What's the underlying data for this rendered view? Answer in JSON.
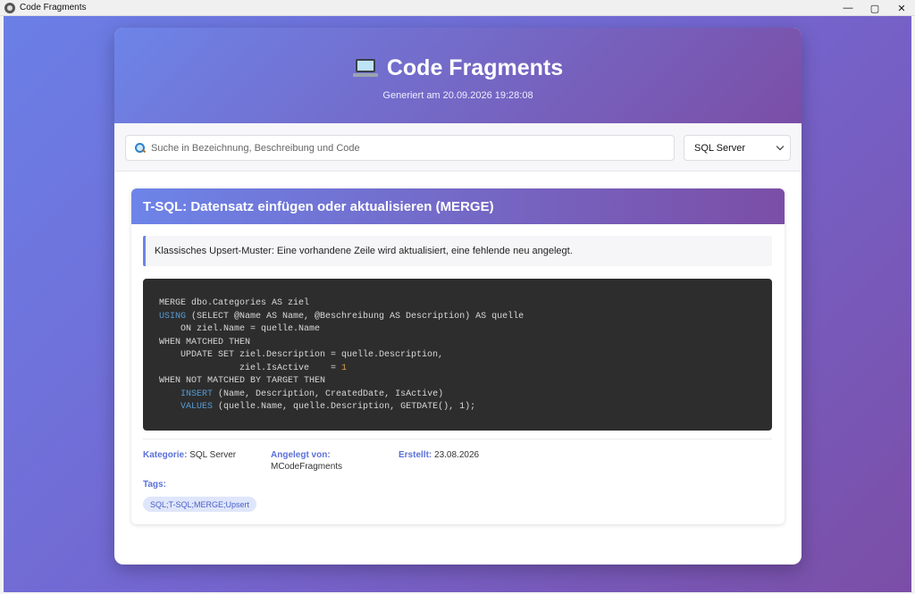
{
  "window": {
    "title": "Code Fragments",
    "minimize": "—",
    "maximize": "▢",
    "close": "✕"
  },
  "header": {
    "title": "Code Fragments",
    "subtitle": "Generiert am 20.09.2026 19:28:08"
  },
  "toolbar": {
    "search_placeholder": "Suche in Bezeichnung, Beschreibung und Code",
    "search_value": "",
    "filter_selected": "SQL Server"
  },
  "snippet": {
    "title": "T-SQL: Datensatz einfügen oder aktualisieren (MERGE)",
    "description": "Klassisches Upsert-Muster: Eine vorhandene Zeile wird aktualisiert, eine fehlende neu angelegt.",
    "code_lines": [
      [
        "MERGE dbo.Categories AS ziel"
      ],
      [
        {
          "kw": "USING"
        },
        " (SELECT @Name AS Name, @Beschreibung AS Description) AS quelle"
      ],
      [
        "    ON ziel.Name = quelle.Name"
      ],
      [
        "WHEN MATCHED THEN"
      ],
      [
        "    UPDATE SET ziel.Description = quelle.Description,"
      ],
      [
        "               ziel.IsActive    = ",
        {
          "num": "1"
        }
      ],
      [
        "WHEN NOT MATCHED BY TARGET THEN"
      ],
      [
        "    ",
        {
          "kw": "INSERT"
        },
        " (Name, Description, CreatedDate, IsActive)"
      ],
      [
        "    ",
        {
          "kw": "VALUES"
        },
        " (quelle.Name, quelle.Description, GETDATE(), 1);"
      ]
    ],
    "meta": {
      "kategorie_label": "Kategorie:",
      "kategorie_value": "SQL Server",
      "angelegt_label": "Angelegt von:",
      "angelegt_value": "MCodeFragments",
      "erstellt_label": "Erstellt:",
      "erstellt_value": "23.08.2026"
    },
    "tags_label": "Tags:",
    "tags": "SQL;T-SQL;MERGE;Upsert"
  }
}
